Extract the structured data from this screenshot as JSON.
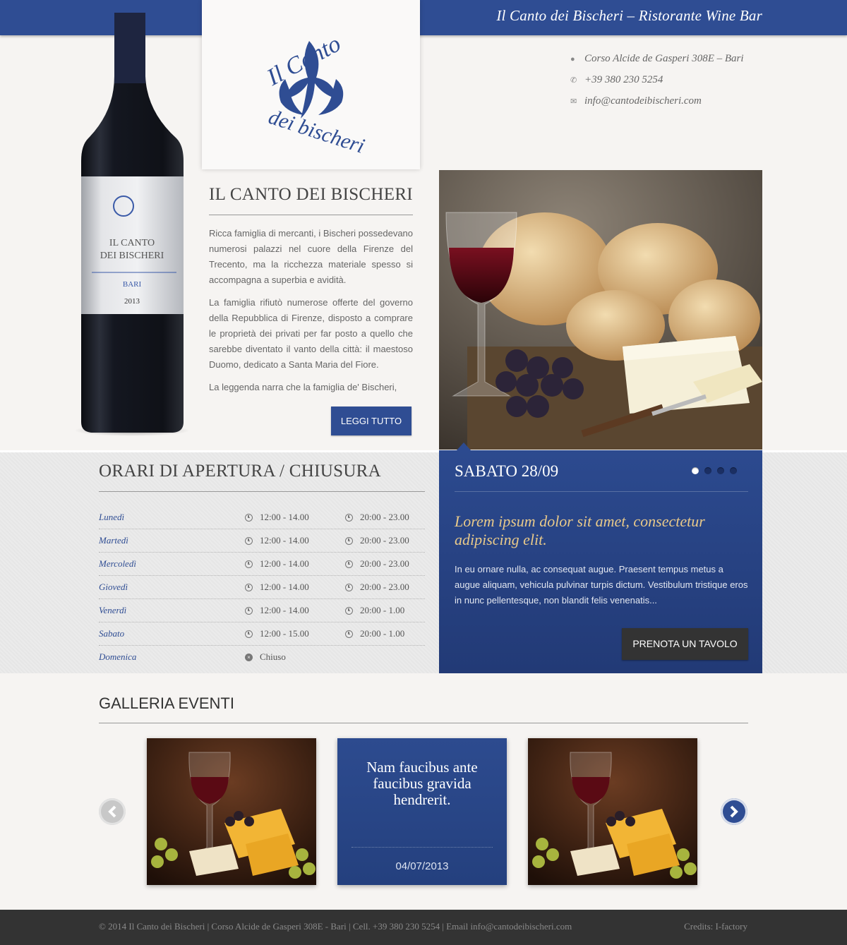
{
  "header": {
    "site_title": "Il Canto dei Bischeri – Ristorante Wine Bar"
  },
  "logo": {
    "text_top": "Il Canto",
    "text_bottom": "dei bischeri",
    "color": "#2f4d93"
  },
  "contact": {
    "address": "Corso Alcide de Gasperi 308E – Bari",
    "phone": "+39 380 230 5254",
    "email": "info@cantodeibischeri.com",
    "icons": [
      "map-pin-icon",
      "phone-icon",
      "envelope-icon"
    ]
  },
  "bottle_label": {
    "line1": "IL CANTO",
    "line2": "DEI BISCHERI",
    "city": "BARI",
    "year": "2013"
  },
  "intro": {
    "title": "IL CANTO DEI BISCHERI",
    "paragraphs": [
      "Ricca famiglia di mercanti, i Bischeri possedevano numerosi palazzi nel cuore della Firenze del Trecento, ma la ricchezza materiale spesso si accompagna a superbia e avidità.",
      "La famiglia rifiutò numerose offerte del governo della Repubblica di Firenze, disposto a comprare le proprietà dei privati per far posto a quello che sarebbe diventato il vanto della città: il maestoso Duomo, dedicato a Santa Maria del Fiore.",
      "La leggenda narra che la famiglia de' Bischeri,"
    ],
    "read_more": "LEGGI TUTTO"
  },
  "hours": {
    "title": "ORARI DI APERTURA / CHIUSURA",
    "rows": [
      {
        "day": "Lunedì",
        "slot1": "12:00 - 14.00",
        "slot2": "20:00 - 23.00"
      },
      {
        "day": "Martedì",
        "slot1": "12:00 - 14.00",
        "slot2": "20:00 - 23.00"
      },
      {
        "day": "Mercoledì",
        "slot1": "12:00 - 14.00",
        "slot2": "20:00 - 23.00"
      },
      {
        "day": "Giovedì",
        "slot1": "12:00 - 14.00",
        "slot2": "20:00 - 23.00"
      },
      {
        "day": "Venerdì",
        "slot1": "12:00 - 14.00",
        "slot2": "20:00 - 1.00"
      },
      {
        "day": "Sabato",
        "slot1": "12:00 - 15.00",
        "slot2": "20:00 - 1.00"
      },
      {
        "day": "Domenica",
        "slot1": "Chiuso",
        "slot2": ""
      }
    ]
  },
  "event": {
    "date": "SABATO 28/09",
    "headline": "Lorem ipsum dolor sit amet, consectetur adipiscing elit.",
    "text": "In eu ornare nulla, ac consequat augue. Praesent tempus metus a augue aliquam, vehicula pulvinar turpis dictum. Vestibulum tristique eros in nunc pellentesque, non blandit felis venenatis...",
    "button": "PRENOTA UN TAVOLO",
    "slide_count": 4,
    "active_slide": 1
  },
  "gallery": {
    "title": "GALLERIA EVENTI",
    "text_card": {
      "title": "Nam faucibus ante faucibus gravida hendrerit.",
      "date": "04/07/2013"
    }
  },
  "footer": {
    "text": "© 2014 Il Canto dei Bischeri | Corso Alcide de Gasperi 308E - Bari | Cell. +39 380 230 5254 | Email info@cantodeibischeri.com",
    "credits": "Credits: I-factory"
  },
  "colors": {
    "brand_blue": "#2f4d93",
    "accent_gold": "#e8c98a",
    "footer_bg": "#333333"
  }
}
